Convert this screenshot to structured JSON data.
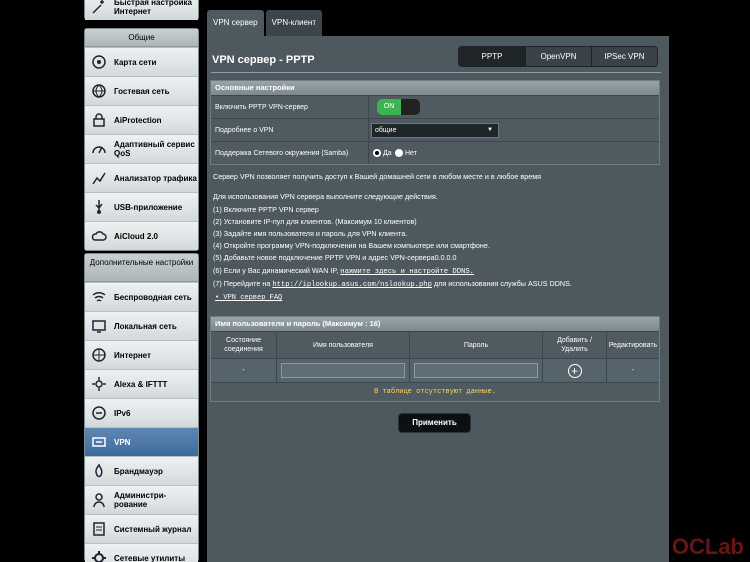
{
  "sidebar": {
    "top_item": "Быстрая настройка Интернет",
    "general_header": "Общие",
    "general_items": [
      {
        "label": "Карта сети",
        "icon": "network-map-icon"
      },
      {
        "label": "Гостевая сеть",
        "icon": "globe-icon"
      },
      {
        "label": "AiProtection",
        "icon": "lock-icon"
      },
      {
        "label": "Адаптивный сервис QoS",
        "icon": "qos-icon"
      },
      {
        "label": "Анализатор трафика",
        "icon": "analyzer-icon"
      },
      {
        "label": "USB-приложение",
        "icon": "usb-icon"
      },
      {
        "label": "AiCloud 2.0",
        "icon": "cloud-icon"
      }
    ],
    "advanced_header": "Дополнительные настройки",
    "advanced_items": [
      {
        "label": "Беспроводная сеть",
        "icon": "wifi-icon"
      },
      {
        "label": "Локальная сеть",
        "icon": "lan-icon"
      },
      {
        "label": "Интернет",
        "icon": "globe-icon"
      },
      {
        "label": "Alexa & IFTTT",
        "icon": "gear-icon"
      },
      {
        "label": "IPv6",
        "icon": "ipv6-icon"
      },
      {
        "label": "VPN",
        "icon": "vpn-icon",
        "active": true
      },
      {
        "label": "Брандмауэр",
        "icon": "firewall-icon"
      },
      {
        "label": "Администри-рование",
        "icon": "admin-icon"
      },
      {
        "label": "Системный журнал",
        "icon": "log-icon"
      },
      {
        "label": "Сетевые утилиты",
        "icon": "tools-icon"
      }
    ]
  },
  "tabs": [
    "VPN сервер",
    "VPN-клиент"
  ],
  "panel": {
    "title": "VPN сервер - PPTP",
    "segments": [
      "PPTP",
      "OpenVPN",
      "IPSec VPN"
    ],
    "basic": {
      "header": "Основные настройки",
      "enable_label": "Включить PPTP VPN-сервер",
      "toggle": "ON",
      "details_label": "Подробнее о VPN",
      "details_value": "общие",
      "samba_label": "Поддержка Сетевого окружения (Samba)",
      "yes": "Да",
      "no": "Нет"
    },
    "intro": "Сервер VPN позволяет получить доступ к Вашей домашней сети в любом месте и в любое время",
    "steps_title": "Для использования VPN сервера выполните следующие действия.",
    "steps": [
      "(1) Включите PPTP VPN сервер",
      "(2) Установите IP-пул для клиентов. (Максимум 10 клиентов)",
      "(3) Задайте имя пользователя и пароль для VPN клиента.",
      "(4) Откройте программу VPN-подключения на Вашем компьютере или смартфоне.",
      "(5) Добавьте новое подключение PPTP VPN и адрес VPN-сервера0.0.0.0"
    ],
    "step6_text": "(6) Если у Вас динамический WAN IP,",
    "step6_link": "нажмите здесь и настройте DDNS.",
    "step7_text": "(7) Перейдите на",
    "step7_link": "http://iplookup.asus.com/nslookup.php",
    "step7_tail": "для использования службы ASUS DDNS.",
    "faq_link": "VPN сервер FAQ",
    "users": {
      "header": "Имя пользователя и пароль (Максимум : 16)",
      "col_status": "Состояние соединения",
      "col_user": "Имя пользователя",
      "col_pass": "Пароль",
      "col_add": "Добавить / Удалить",
      "col_edit": "Редактировать",
      "dash1": "-",
      "dash2": "-",
      "empty": "В таблице отсутствуют данные."
    },
    "apply": "Применить"
  },
  "watermark": "OCLab"
}
